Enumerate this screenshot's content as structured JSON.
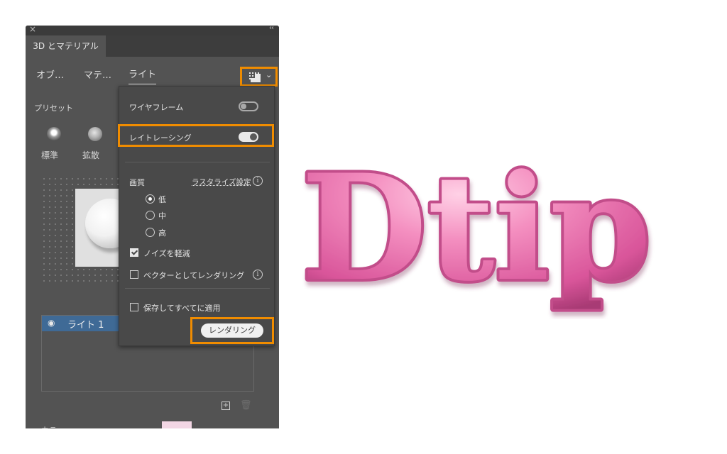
{
  "window": {
    "close_glyph": "×",
    "collapse_glyph": "‹‹",
    "tab_label": "3D とマテリアル"
  },
  "subtabs": [
    {
      "label": "オブ…"
    },
    {
      "label": "マテ…"
    },
    {
      "label": "ライト"
    }
  ],
  "preset": {
    "label": "プリセット",
    "items": [
      {
        "label": "標準"
      },
      {
        "label": "拡散"
      }
    ]
  },
  "lights": {
    "items": [
      {
        "label": "ライト 1"
      }
    ],
    "color_label": "カラ"
  },
  "render_menu": {
    "wireframe_label": "ワイヤフレーム",
    "wireframe_on": false,
    "raytracing_label": "レイトレーシング",
    "raytracing_on": true,
    "quality_label": "画質",
    "rasterize_settings_label": "ラスタライズ設定",
    "quality_options": [
      {
        "label": "低",
        "selected": true
      },
      {
        "label": "中",
        "selected": false
      },
      {
        "label": "高",
        "selected": false
      }
    ],
    "noise_reduction_label": "ノイズを軽減",
    "noise_reduction_checked": true,
    "vector_render_label": "ベクターとしてレンダリング",
    "vector_render_checked": false,
    "save_apply_all_label": "保存してすべてに適用",
    "save_apply_all_checked": false,
    "render_button_label": "レンダリング"
  },
  "artwork": {
    "text": "Dtip",
    "fill_color": "#f07bb3"
  },
  "colors": {
    "panel_bg": "#535353",
    "highlight": "#f08c00",
    "selected_row": "#3f6a96"
  }
}
